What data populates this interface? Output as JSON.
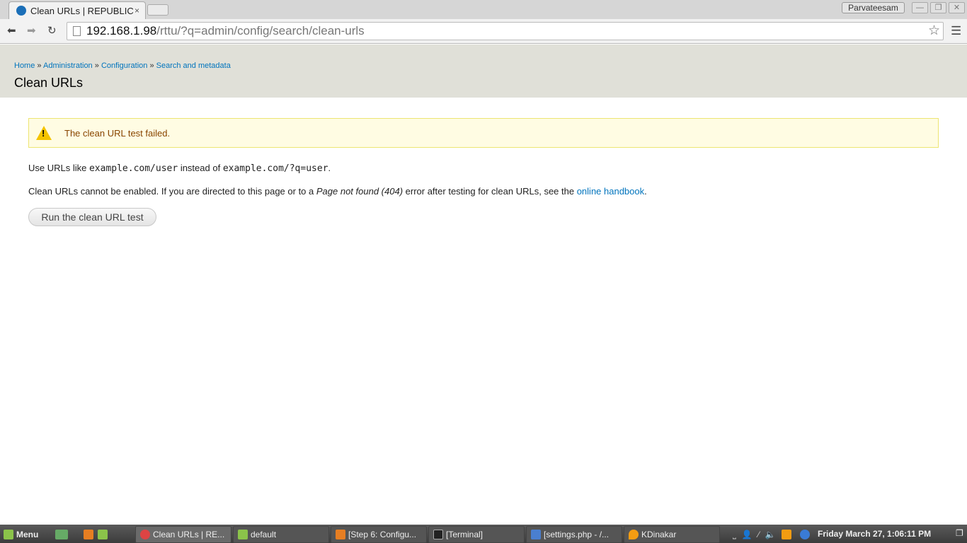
{
  "browser": {
    "tab_title": "Clean URLs | REPUBLIC",
    "tab_close": "×",
    "user": "Parvateesam",
    "url_host": "192.168.1.98",
    "url_path": "/rttu/?q=admin/config/search/clean-urls"
  },
  "breadcrumb": [
    {
      "label": "Home"
    },
    {
      "label": "Administration"
    },
    {
      "label": "Configuration"
    },
    {
      "label": "Search and metadata"
    }
  ],
  "breadcrumb_sep": "»",
  "page": {
    "title": "Clean URLs",
    "warning": "The clean URL test failed.",
    "p1_a": "Use URLs like ",
    "p1_code1": "example.com/user",
    "p1_b": " instead of ",
    "p1_code2": "example.com/?q=user",
    "p1_c": ".",
    "p2_a": "Clean URLs cannot be enabled. If you are directed to this page or to a ",
    "p2_em": "Page not found (404)",
    "p2_b": " error after testing for clean URLs, see the ",
    "p2_link": "online handbook",
    "p2_c": ".",
    "button": "Run the clean URL test"
  },
  "taskbar": {
    "menu": "Menu",
    "tasks": [
      {
        "label": "Clean URLs | RE...",
        "color": "#d44"
      },
      {
        "label": "default",
        "color": "#8bc34a"
      },
      {
        "label": "[Step 6: Configu...",
        "color": "#e67e22"
      },
      {
        "label": "[Terminal]",
        "color": "#222"
      },
      {
        "label": "[settings.php - /...",
        "color": "#4a7fd0"
      },
      {
        "label": "KDinakar",
        "color": "#f39c12"
      }
    ],
    "clock": "Friday March 27,  1:06:11 PM"
  },
  "colors": {
    "link": "#0074bd",
    "warning_bg": "#fffce3",
    "header_bg": "#e0e0d8"
  }
}
